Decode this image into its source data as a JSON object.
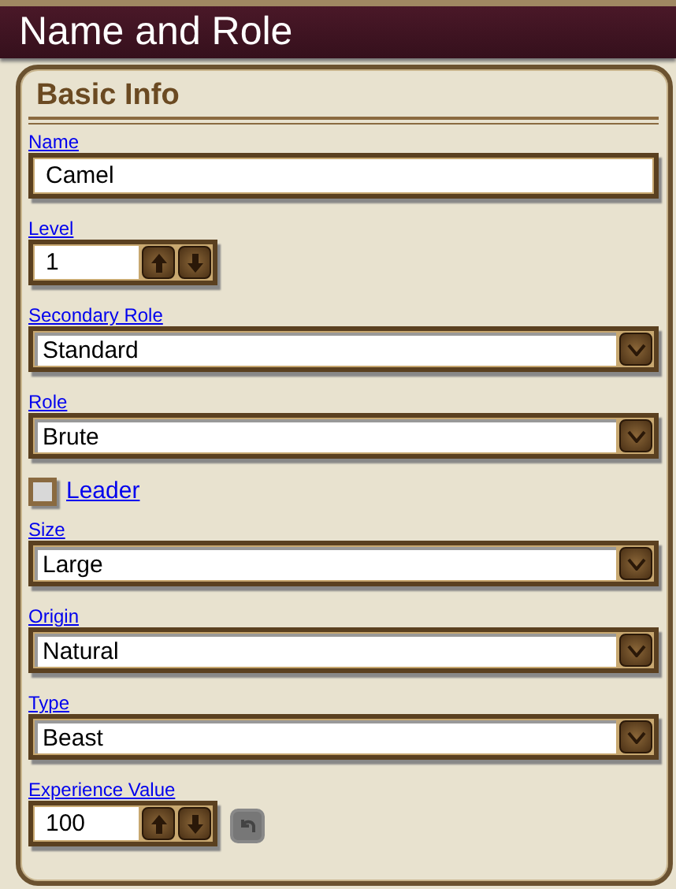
{
  "window": {
    "title": "Name and Role"
  },
  "section": {
    "title": "Basic Info"
  },
  "fields": [
    {
      "kind": "text",
      "label": "Name",
      "value": "Camel"
    },
    {
      "kind": "spinner",
      "label": "Level",
      "value": "1"
    },
    {
      "kind": "select",
      "label": "Secondary Role",
      "value": "Standard"
    },
    {
      "kind": "select",
      "label": "Role",
      "value": "Brute"
    },
    {
      "kind": "checkbox",
      "label": "Leader",
      "checked": false
    },
    {
      "kind": "select",
      "label": "Size",
      "value": "Large"
    },
    {
      "kind": "select",
      "label": "Origin",
      "value": "Natural"
    },
    {
      "kind": "select",
      "label": "Type",
      "value": "Beast"
    },
    {
      "kind": "spinner",
      "label": "Experience Value",
      "value": "100",
      "reset": {
        "disabled": true
      }
    }
  ]
}
